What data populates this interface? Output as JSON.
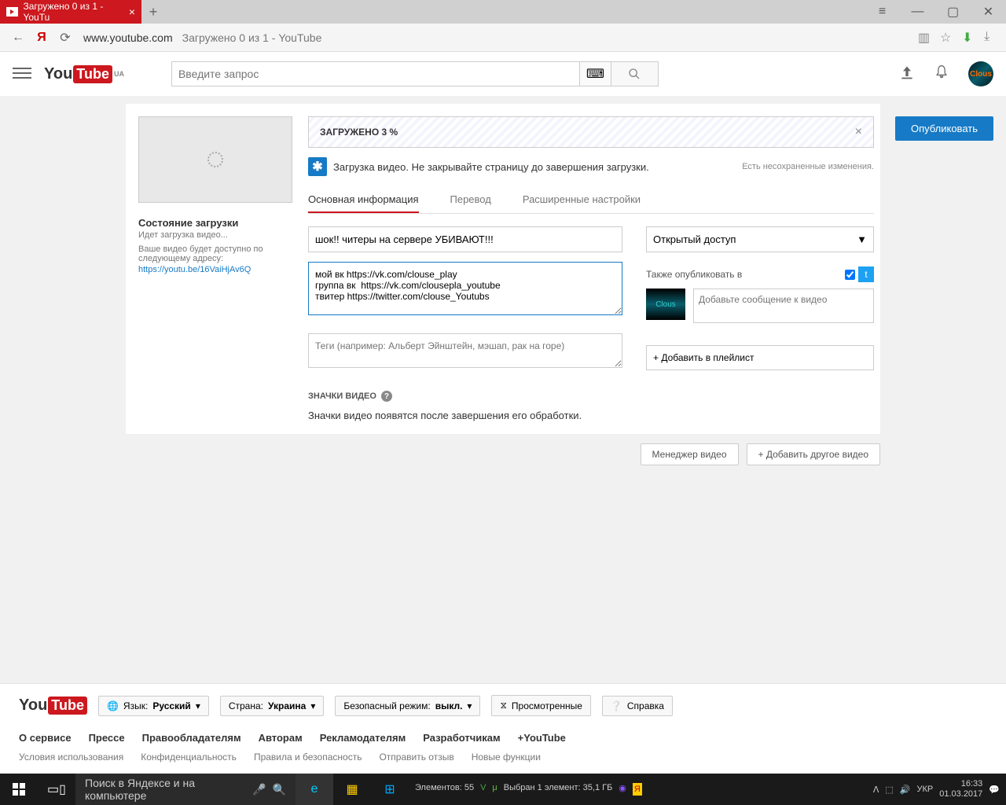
{
  "browser": {
    "tab_title": "Загружено 0 из 1 - YouTu",
    "url_domain": "www.youtube.com",
    "url_path": "Загружено 0 из 1 - YouTube"
  },
  "header": {
    "logo_you": "You",
    "logo_tube": "Tube",
    "logo_region": "UA",
    "search_placeholder": "Введите запрос"
  },
  "upload": {
    "progress_label": "ЗАГРУЖЕНО 3 %",
    "info_message": "Загрузка видео. Не закрывайте страницу до завершения загрузки.",
    "unsaved_message": "Есть несохраненные изменения.",
    "publish_label": "Опубликовать",
    "status_title": "Состояние загрузки",
    "status_uploading": "Идет загрузка видео...",
    "status_available": "Ваше видео будет доступно по следующему адресу:",
    "status_url": "https://youtu.be/16VaiHjAv6Q",
    "tabs": {
      "basic": "Основная информация",
      "translations": "Перевод",
      "advanced": "Расширенные настройки"
    },
    "title_value": "шок!! читеры на сервере УБИВАЮТ!!!",
    "description_value": "мой вк https://vk.com/clouse_play\nгруппа вк  https://vk.com/clousepla_youtube\nтвитер https://twitter.com/clouse_Youtubs",
    "tags_placeholder": "Теги (например: Альберт Эйнштейн, мэшап, рак на горе)",
    "privacy_label": "Открытый доступ",
    "also_publish_label": "Также опубликовать в",
    "share_placeholder": "Добавьте сообщение к видео",
    "playlist_label": "+ Добавить в плейлист",
    "thumbs_heading": "ЗНАЧКИ ВИДЕО",
    "thumbs_text": "Значки видео появятся после завершения его обработки.",
    "video_manager_label": "Менеджер видео",
    "add_more_label": "Добавить другое видео"
  },
  "footer": {
    "logo_you": "You",
    "logo_tube": "Tube",
    "language_label": "Язык:",
    "language_value": "Русский",
    "country_label": "Страна:",
    "country_value": "Украина",
    "safety_label": "Безопасный режим:",
    "safety_value": "выкл.",
    "history_label": "Просмотренные",
    "help_label": "Справка",
    "links1": [
      "О сервисе",
      "Прессе",
      "Правообладателям",
      "Авторам",
      "Рекламодателям",
      "Разработчикам",
      "+YouTube"
    ],
    "links2": [
      "Условия использования",
      "Конфиденциальность",
      "Правила и безопасность",
      "Отправить отзыв",
      "Новые функции"
    ]
  },
  "taskbar": {
    "search_placeholder": "Поиск в Яндексе и на компьютере",
    "items_label": "Элементов: 55",
    "selected_label": "Выбран 1 элемент: 35,1 ГБ",
    "lang": "УКР",
    "time": "16:33",
    "date": "01.03.2017"
  }
}
